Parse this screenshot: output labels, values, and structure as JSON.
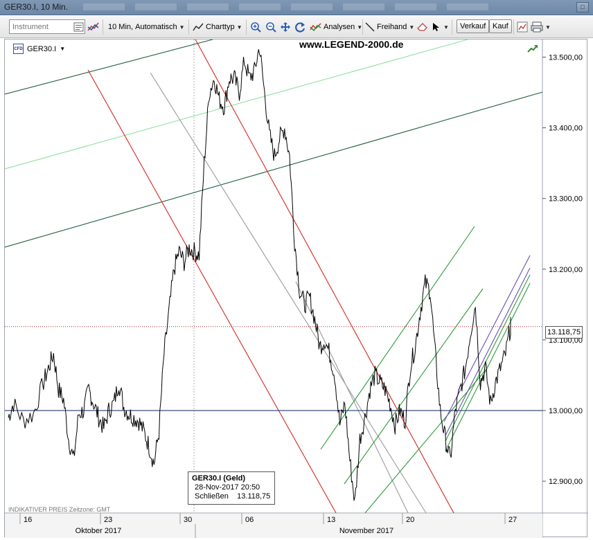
{
  "window": {
    "title": "GER30.I, 10 Min."
  },
  "toolbar": {
    "instrument_placeholder": "Instrument",
    "interval_label": "10 Min,",
    "interval_mode": "Automatisch",
    "charttyp_label": "Charttyp",
    "analysen_label": "Analysen",
    "freihand_label": "Freihand",
    "verkauf_label": "Verkauf",
    "kauf_label": "Kauf"
  },
  "chart": {
    "instrument": "GER30.I",
    "cfd_badge": "CFD",
    "watermark": "www.LEGEND-2000.de",
    "current_price_label": "13.118,75",
    "footer_note": "INDIKATIVER PREIS   Zeitzone: GMT",
    "infobox": {
      "title": "GER30.I (Geld)",
      "datetime": "28-Nov-2017 20:50",
      "close_label": "Schließen",
      "close_value": "13.118,75"
    }
  },
  "chart_data": {
    "type": "line",
    "title": "",
    "instrument": "GER30.I",
    "interval": "10 Min",
    "y_ticks": [
      "13.500,00",
      "13.400,00",
      "13.300,00",
      "13.200,00",
      "13.100,00",
      "13.000,00",
      "12.900,00"
    ],
    "y_tick_values": [
      13500,
      13400,
      13300,
      13200,
      13100,
      13000,
      12900
    ],
    "ylim": [
      12855,
      13525
    ],
    "x_day_ticks": [
      "16",
      "23",
      "30",
      "06",
      "13",
      "20",
      "27"
    ],
    "x_month_labels": [
      "Oktober 2017",
      "November 2017"
    ],
    "horizontal_line": 13000,
    "current_price": 13118.75,
    "series": [
      {
        "x": [
          0,
          1,
          3,
          5,
          7,
          8,
          9,
          10,
          11,
          12,
          13,
          14,
          15,
          16,
          17,
          18,
          19,
          20,
          21,
          22,
          23,
          24,
          25,
          26,
          27,
          28,
          29,
          30,
          31,
          32,
          33,
          34,
          35,
          36,
          37,
          38,
          39,
          40,
          41,
          42,
          43,
          44,
          45,
          46,
          47,
          48,
          49,
          50,
          51,
          52,
          53,
          54,
          55,
          56,
          57,
          58,
          59,
          60,
          61,
          62,
          63,
          64,
          65,
          66,
          67,
          68,
          69,
          70,
          71,
          72,
          73,
          74,
          75,
          76,
          77,
          78,
          79,
          80,
          81,
          82,
          83,
          84,
          85,
          86,
          87,
          88,
          89,
          90,
          91,
          92,
          93,
          94,
          95,
          96,
          97,
          98,
          99,
          100
        ],
        "values": [
          12990,
          13010,
          12985,
          12995,
          13040,
          13060,
          13080,
          13030,
          13015,
          12960,
          12930,
          12995,
          13000,
          13030,
          13010,
          12990,
          12975,
          13000,
          13010,
          13040,
          13005,
          12995,
          12990,
          12985,
          12970,
          12950,
          12925,
          12970,
          13080,
          13140,
          13200,
          13225,
          13210,
          13230,
          13225,
          13220,
          13350,
          13450,
          13470,
          13440,
          13430,
          13470,
          13470,
          13450,
          13495,
          13470,
          13480,
          13515,
          13450,
          13390,
          13360,
          13385,
          13400,
          13360,
          13240,
          13170,
          13150,
          13160,
          13130,
          13090,
          13100,
          13080,
          13050,
          12980,
          13010,
          12930,
          12870,
          12960,
          12990,
          13030,
          13050,
          13040,
          13030,
          13010,
          12980,
          13000,
          12985,
          13060,
          13090,
          13140,
          13180,
          13170,
          13080,
          13000,
          12960,
          12930,
          13000,
          13030,
          13060,
          13110,
          13150,
          13040,
          13060,
          13010,
          13040,
          13060,
          13080,
          13118.75
        ]
      }
    ]
  },
  "colors": {
    "price_line": "#000000",
    "red_channel": "#d0281e",
    "gray_channel": "#9a9a9a",
    "dark_green_channel": "#1f5d3a",
    "light_green_channel": "#8fe0a0",
    "green_channel": "#2e9a3a",
    "purple_channel": "#6a4fb0",
    "horizontal_level": "#3a4a7a",
    "current_price_dots": "#b02020"
  }
}
